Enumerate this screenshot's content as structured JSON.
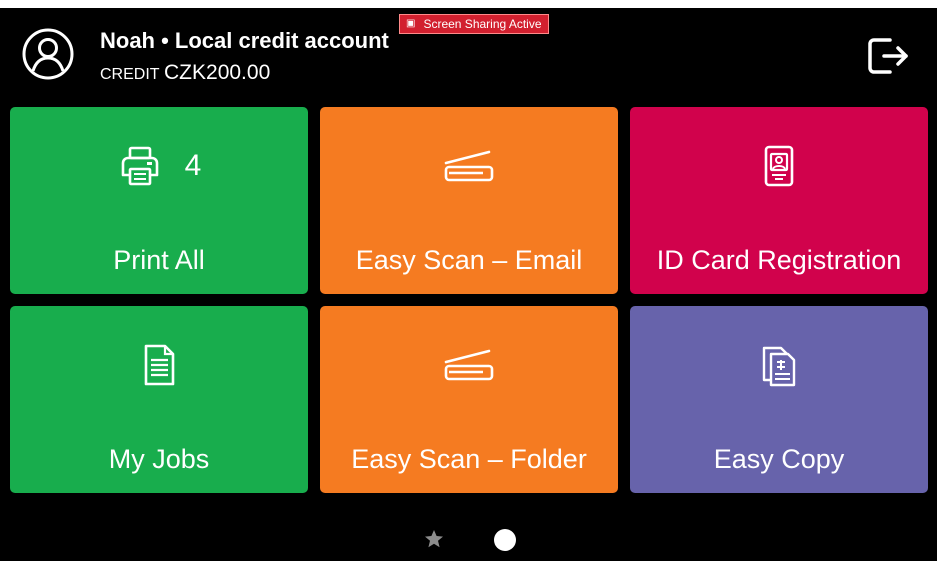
{
  "header": {
    "user_name": "Noah • Local credit account",
    "credit_label": "CREDIT",
    "credit_value": "CZK200.00",
    "screen_sharing": "Screen Sharing Active"
  },
  "tiles": [
    {
      "label": "Print All",
      "count": "4",
      "icon": "printer-icon",
      "color": "#18ad4d"
    },
    {
      "label": "Easy Scan – Email",
      "icon": "scanner-icon",
      "color": "#f57b21"
    },
    {
      "label": "ID Card Registration",
      "icon": "id-card-icon",
      "color": "#d1024c"
    },
    {
      "label": "My Jobs",
      "icon": "document-icon",
      "color": "#18ad4d"
    },
    {
      "label": "Easy Scan – Folder",
      "icon": "scanner-icon",
      "color": "#f57b21"
    },
    {
      "label": "Easy Copy",
      "icon": "copy-icon",
      "color": "#6763ab"
    }
  ],
  "pagination": {
    "pages": [
      "favorites",
      "page-1"
    ],
    "active": "page-1"
  }
}
